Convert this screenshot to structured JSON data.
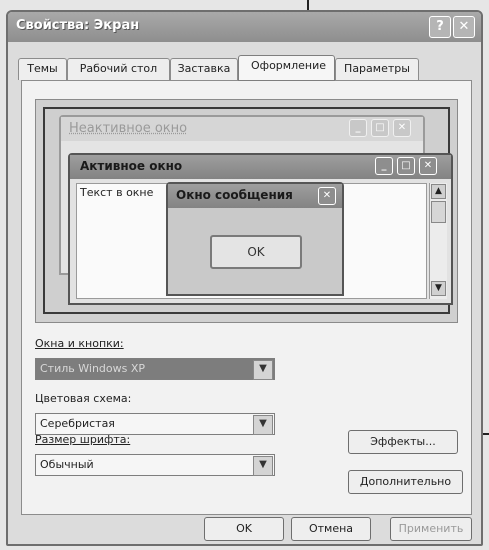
{
  "window": {
    "title": "Свойства: Экран"
  },
  "title_buttons": {
    "help": "?",
    "close": "✕"
  },
  "tabs": [
    {
      "label": "Темы"
    },
    {
      "label": "Рабочий стол"
    },
    {
      "label": "Заставка"
    },
    {
      "label": "Оформление",
      "selected": true
    },
    {
      "label": "Параметры"
    }
  ],
  "preview": {
    "inactive_title": "Неактивное окно",
    "active_title": "Активное окно",
    "window_text": "Текст в окне",
    "message_title": "Окно сообщения",
    "ok_label": "OK"
  },
  "windows_buttons": {
    "label": "Окна и кнопки:",
    "value": "Стиль Windows XP"
  },
  "color_scheme": {
    "label": "Цветовая схема:",
    "value": "Серебристая"
  },
  "font_size": {
    "label": "Размер шрифта:",
    "value": "Обычный"
  },
  "buttons": {
    "effects": "Эффекты...",
    "advanced": "Дополнительно",
    "ok": "OK",
    "cancel": "Отмена",
    "apply": "Применить"
  },
  "colors": {
    "window_frame": "#6e6e6e",
    "titlebar": "#8e8e8e",
    "dialog_bg": "#dcdcdc",
    "selected_dropdown": "#7d7d7d"
  }
}
